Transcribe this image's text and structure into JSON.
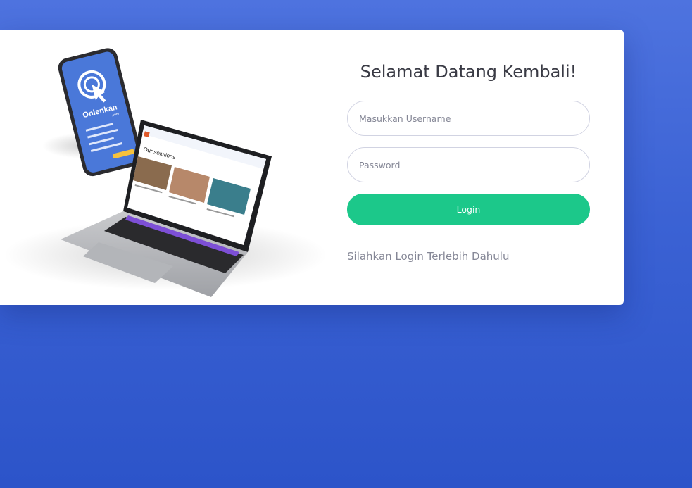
{
  "login": {
    "title": "Selamat Datang Kembali!",
    "username_placeholder": "Masukkan Username",
    "password_placeholder": "Password",
    "button_label": "Login",
    "subtitle": "Silahkan Login Terlebih Dahulu"
  },
  "illustration": {
    "phone_brand": "Onlenkan",
    "phone_brand_sub": ".com",
    "laptop_heading": "Our solutions"
  },
  "colors": {
    "background": "#4e73df",
    "login_button": "#1cc88a",
    "phone_screen": "#4a78d9",
    "card": "#ffffff"
  }
}
